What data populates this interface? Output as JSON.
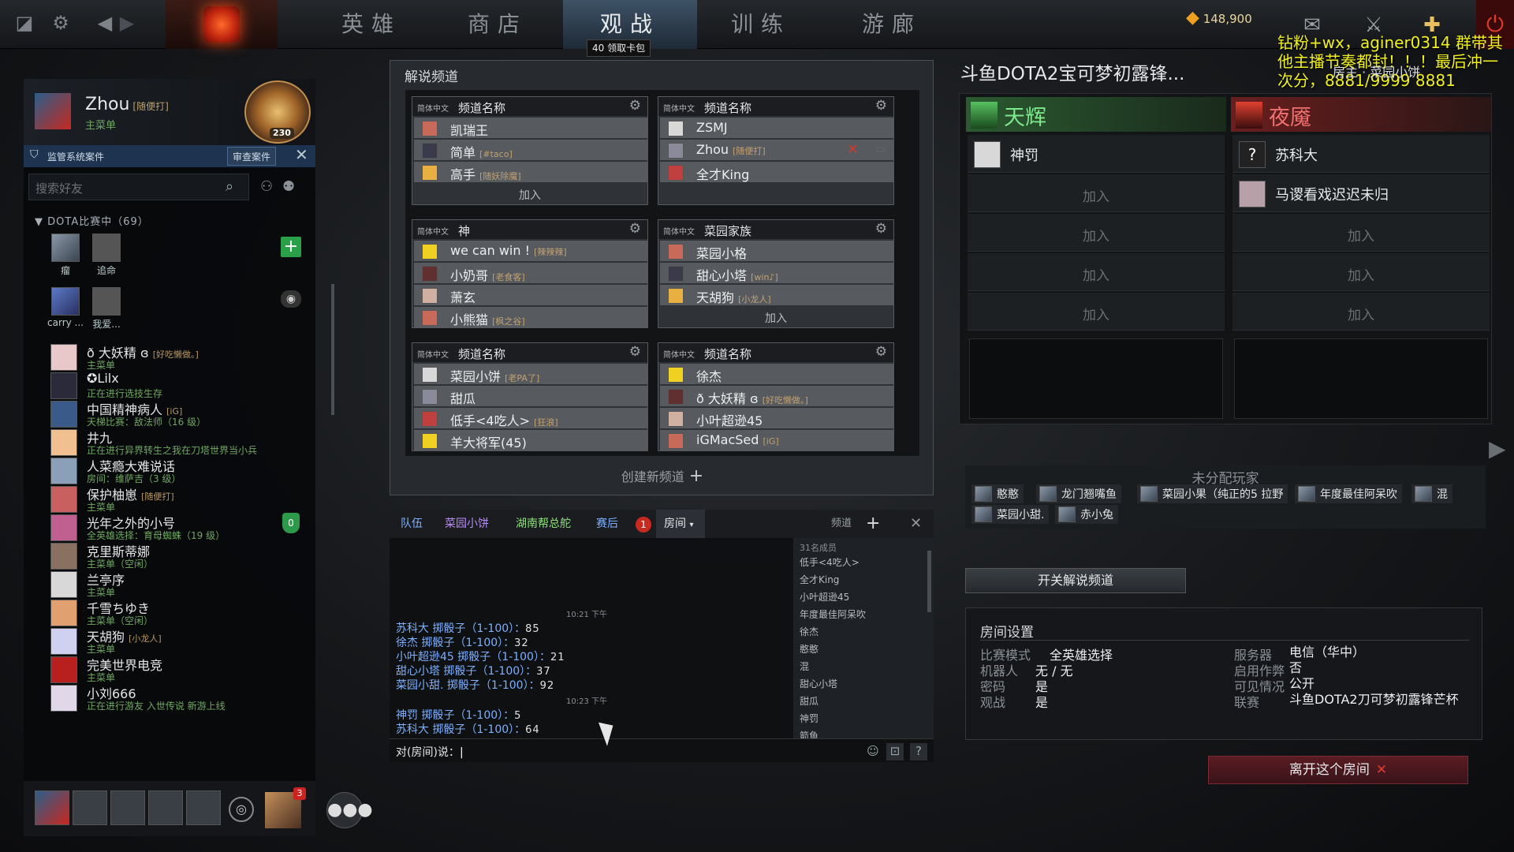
{
  "topbar": {
    "nav": [
      "英雄",
      "商店",
      "观战",
      "训练",
      "游廊"
    ],
    "active_nav": "观战",
    "badge_count": "40",
    "badge_label": "领取卡包",
    "gold": "148,900"
  },
  "overlay_ad": "钻粉+wx，aginer0314 群带其他主播节奏都封！！！最后冲一次分，8881/9999 8881",
  "profile": {
    "name": "Zhou",
    "tag": "[随便打]",
    "status": "主菜单",
    "level": "230"
  },
  "alert": {
    "text": "监管系统案件",
    "button": "审查案件"
  },
  "search_placeholder": "搜索好友",
  "group_header": "DOTA比赛中（69）",
  "ingame": [
    {
      "name": "瘤"
    },
    {
      "name": "追命"
    },
    {
      "name": "carry ..."
    },
    {
      "name": "我爱..."
    }
  ],
  "friends": [
    {
      "name": "ð 大妖精 ɞ",
      "tag": "[好吃懒做。]",
      "status": "主菜单"
    },
    {
      "name": "✪Lilx",
      "tag": "",
      "status": "正在进行选技生存"
    },
    {
      "name": "中国精神病人",
      "tag": "[iG]",
      "status": "天梯比赛：敌法师（16 级）"
    },
    {
      "name": "井九",
      "tag": "",
      "status": "正在进行异界转生之我在刀塔世界当小兵"
    },
    {
      "name": "人菜瘾大难说话",
      "tag": "",
      "status": "房间：维萨吉（3 级）"
    },
    {
      "name": "保护柚崽",
      "tag": "[随便打]",
      "status": "主菜单"
    },
    {
      "name": "光年之外的小号",
      "tag": "",
      "status": "全英雄选择：育母蜘蛛（19 级）"
    },
    {
      "name": "克里斯蒂娜",
      "tag": "",
      "status": "主菜单（空闲）"
    },
    {
      "name": "兰亭序",
      "tag": "",
      "status": "主菜单"
    },
    {
      "name": "千雪ちゆき",
      "tag": "",
      "status": "主菜单（空闲）"
    },
    {
      "name": "天胡狗",
      "tag": "[小龙人]",
      "status": "主菜单"
    },
    {
      "name": "完美世界电竞",
      "tag": "",
      "status": "主菜单"
    },
    {
      "name": "小刘666",
      "tag": "",
      "status": "正在进行游友 入世传说 新游上线"
    }
  ],
  "party": {
    "badge": "3"
  },
  "channels": {
    "title": "解说频道",
    "create": "创建新频道",
    "join": "加入",
    "cards": [
      {
        "lang": "简体中文",
        "name": "频道名称",
        "members": [
          {
            "n": "凯瑞王",
            "t": ""
          },
          {
            "n": "简单",
            "t": "[#taco]"
          },
          {
            "n": "高手",
            "t": "[随妖除魔]"
          }
        ],
        "join": true
      },
      {
        "lang": "简体中文",
        "name": "频道名称",
        "members": [
          {
            "n": "ZSMJ",
            "t": ""
          },
          {
            "n": "Zhou",
            "t": "[随便打]"
          },
          {
            "n": "全才King",
            "t": ""
          }
        ],
        "join": false
      },
      {
        "lang": "简体中文",
        "name": "神",
        "members": [
          {
            "n": "we can win !",
            "t": "[辣辣辣]"
          },
          {
            "n": "小奶哥",
            "t": "[老食客]"
          },
          {
            "n": "萧玄",
            "t": ""
          },
          {
            "n": "小熊猫",
            "t": "[枫之谷]"
          }
        ],
        "join": false
      },
      {
        "lang": "简体中文",
        "name": "菜园家族",
        "members": [
          {
            "n": "菜园小格",
            "t": ""
          },
          {
            "n": "甜心小塔",
            "t": "[win♪]"
          },
          {
            "n": "天胡狗",
            "t": "[小龙人]"
          }
        ],
        "join": true
      },
      {
        "lang": "简体中文",
        "name": "频道名称",
        "members": [
          {
            "n": "菜园小饼",
            "t": "[老PA了]"
          },
          {
            "n": "甜瓜",
            "t": ""
          },
          {
            "n": "低手<4吃人>",
            "t": "[狂浪]"
          },
          {
            "n": "羊大将军(45)",
            "t": ""
          }
        ],
        "join": false
      },
      {
        "lang": "简体中文",
        "name": "频道名称",
        "members": [
          {
            "n": "徐杰",
            "t": ""
          },
          {
            "n": "ð 大妖精 ɞ",
            "t": "[好吃懒做。]"
          },
          {
            "n": "小叶超逊45",
            "t": ""
          },
          {
            "n": "iGMacSed",
            "t": "[iG]"
          }
        ],
        "join": false
      }
    ]
  },
  "chat": {
    "tabs": [
      "队伍",
      "菜园小饼",
      "湖南帮总舵",
      "赛后",
      "房间"
    ],
    "badge": "1",
    "channel_label": "频道",
    "member_count": "31名成员",
    "members": [
      "低手<4吃人>",
      "全才King",
      "小叶超逊45",
      "年度最佳阿呆吹",
      "徐杰",
      "憨憨",
      "混",
      "甜心小塔",
      "甜瓜",
      "神罚",
      "箭鱼"
    ],
    "time1": "10:21 下午",
    "time2": "10:23 下午",
    "lines1": [
      {
        "who": "苏科大",
        "act": "掷骰子（1-100）：",
        "val": "85"
      },
      {
        "who": "徐杰",
        "act": "掷骰子（1-100）：",
        "val": "32"
      },
      {
        "who": "小叶超逊45",
        "act": "掷骰子（1-100）：",
        "val": "21"
      },
      {
        "who": "甜心小塔",
        "act": "掷骰子（1-100）：",
        "val": "37"
      },
      {
        "who": "菜园小甜.",
        "act": "掷骰子（1-100）：",
        "val": "92"
      }
    ],
    "lines2": [
      {
        "who": "神罚",
        "act": "掷骰子（1-100）：",
        "val": "5"
      },
      {
        "who": "苏科大",
        "act": "掷骰子（1-100）：",
        "val": "64"
      }
    ],
    "input_prefix": "对(房间)说："
  },
  "lobby": {
    "title": "斗鱼DOTA2宝可梦初露锋...",
    "host_label": "房主",
    "host_name": "菜园小饼",
    "radiant": "天辉",
    "dire": "夜魇",
    "join": "加入",
    "radiant_players": [
      "神罚"
    ],
    "dire_players": [
      "苏科大",
      "马谡看戏迟迟未归"
    ],
    "unassigned_title": "未分配玩家",
    "unassigned": [
      "憨憨",
      "龙门翘嘴鱼",
      "菜园小果（纯正的5 拉野",
      "年度最佳阿呆吹",
      "混",
      "菜园小甜.",
      "赤小兔"
    ],
    "toggle": "开关解说频道",
    "settings_title": "房间设置",
    "settings": [
      {
        "k": "比赛模式",
        "v": "全英雄选择"
      },
      {
        "k": "机器人",
        "v": "无 / 无"
      },
      {
        "k": "密码",
        "v": "是"
      },
      {
        "k": "观战",
        "v": "是"
      },
      {
        "k": "服务器",
        "v": "电信（华中）"
      },
      {
        "k": "启用作弊",
        "v": "否"
      },
      {
        "k": "可见情况",
        "v": "公开"
      },
      {
        "k": "联赛",
        "v": "斗鱼DOTA2刀可梦初露锋芒杯"
      }
    ],
    "leave": "离开这个房间"
  }
}
